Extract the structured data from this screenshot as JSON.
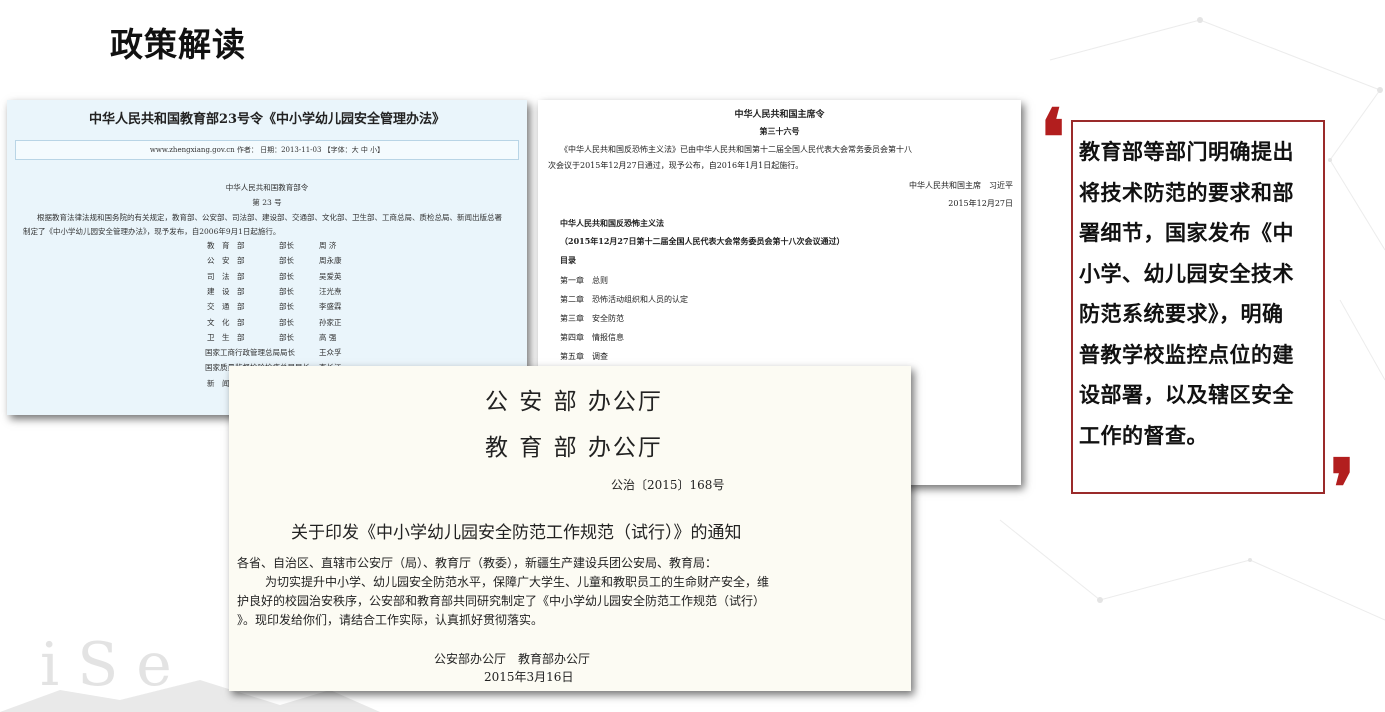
{
  "page_title": "政策解读",
  "doc_a": {
    "title": "中华人民共和国教育部23号令《中小学幼儿园安全管理办法》",
    "meta": "www.zhengxiang.gov.cn  作者：  日期：2013-11-03  【字体：大 中 小】",
    "header": "中华人民共和国教育部令",
    "number": "第  23  号",
    "body1": "根据教育法律法规和国务院的有关规定，教育部、公安部、司法部、建设部、交通部、文化部、卫生部、工商总局、质检总局、新闻出版总署",
    "body2": "制定了《中小学幼儿园安全管理办法》，现予发布，自2006年9月1日起施行。",
    "signatories": [
      {
        "org": "教　育　部",
        "role": "部长",
        "name": "周 济"
      },
      {
        "org": "公　安　部",
        "role": "部长",
        "name": "周永康"
      },
      {
        "org": "司　法　部",
        "role": "部长",
        "name": "吴爱英"
      },
      {
        "org": "建　设　部",
        "role": "部长",
        "name": "汪光焘"
      },
      {
        "org": "交　通　部",
        "role": "部长",
        "name": "李盛霖"
      },
      {
        "org": "文　化　部",
        "role": "部长",
        "name": "孙家正"
      },
      {
        "org": "卫　生　部",
        "role": "部长",
        "name": "高 强"
      },
      {
        "org": "国家工商行政管理总局局长",
        "role": "",
        "name": "王众孚"
      },
      {
        "org": "国家质量监督检验检疫总局局长",
        "role": "",
        "name": "李长江"
      },
      {
        "org": "新　闻",
        "role": "",
        "name": ""
      }
    ]
  },
  "doc_b": {
    "header1": "中华人民共和国主席令",
    "header2": "第三十六号",
    "body1": "《中华人民共和国反恐怖主义法》已由中华人民共和国第十二届全国人民代表大会常务委员会第十八",
    "body2": "次会议于2015年12月27日通过，现予公布，自2016年1月1日起施行。",
    "sign": "中华人民共和国主席　习近平",
    "sign_date": "2015年12月27日",
    "law_title": "中华人民共和国反恐怖主义法",
    "law_sub": "（2015年12月27日第十二届全国人民代表大会常务委员会第十八次会议通过）",
    "toc": "目录",
    "chapters": [
      "第一章　总则",
      "第二章　恐怖活动组织和人员的认定",
      "第三章　安全防范",
      "第四章　情报信息",
      "第五章　调查"
    ]
  },
  "doc_c": {
    "org1": "公 安 部 办公厅",
    "org2": "教 育 部 办公厅",
    "docno": "公治〔2015〕168号",
    "title": "关于印发《中小学幼儿园安全防范工作规范（试行）》的通知",
    "p1": "各省、自治区、直辖市公安厅（局）、教育厅（教委），新疆生产建设兵团公安局、教育局：",
    "p2": "为切实提升中小学、幼儿园安全防范水平，保障广大学生、儿童和教职员工的生命财产安全，维",
    "p3": "护良好的校园治安秩序，公安部和教育部共同研究制定了《中小学幼儿园安全防范工作规范（试行）",
    "p4": "》。现印发给你们，请结合工作实际，认真抓好贯彻落实。",
    "sign": "公安部办公厅　教育部办公厅",
    "date": "2015年3月16日"
  },
  "quote": {
    "lines": [
      "教育部等部门明确提出",
      "将技术防范的要求和部",
      "署细节，国家发布《中",
      "小学、幼儿园安全技术",
      "防范系统要求》，明确",
      "普教学校监控点位的建",
      "设部署，以及辖区安全",
      "工作的督查。"
    ]
  },
  "colors": {
    "accent": "#b21e1e",
    "border": "#9a2a2a"
  }
}
